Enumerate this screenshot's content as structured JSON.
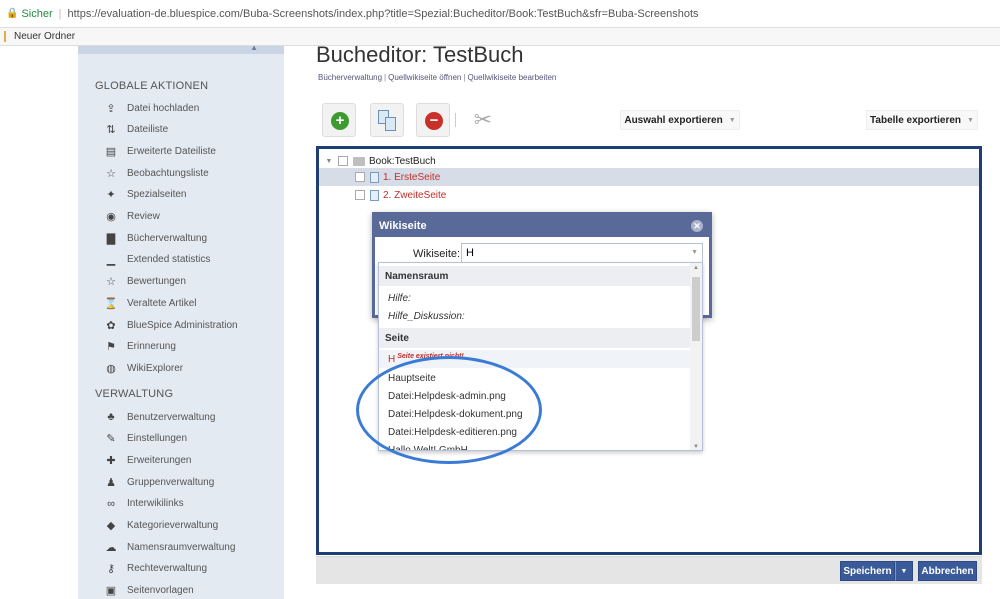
{
  "browser": {
    "secure_label": "Sicher",
    "url": "https://evaluation-de.bluespice.com/Buba-Screenshots/index.php?title=Spezial:Bucheditor/Book:TestBuch&sfr=Buba-Screenshots",
    "bookmark_folder": "Neuer Ordner"
  },
  "sidebar": {
    "global_title": "GLOBALE AKTIONEN",
    "global_items": [
      {
        "label": "Datei hochladen",
        "icon": "upload-icon"
      },
      {
        "label": "Dateiliste",
        "icon": "sort-icon"
      },
      {
        "label": "Erweiterte Dateiliste",
        "icon": "list-icon"
      },
      {
        "label": "Beobachtungsliste",
        "icon": "star-icon"
      },
      {
        "label": "Spezialseiten",
        "icon": "special-icon"
      },
      {
        "label": "Review",
        "icon": "eye-icon"
      },
      {
        "label": "Bücherverwaltung",
        "icon": "book-icon"
      },
      {
        "label": "Extended statistics",
        "icon": "chart-icon"
      },
      {
        "label": "Bewertungen",
        "icon": "star-icon"
      },
      {
        "label": "Veraltete Artikel",
        "icon": "hourglass-icon"
      },
      {
        "label": "BlueSpice Administration",
        "icon": "gear-icon"
      },
      {
        "label": "Erinnerung",
        "icon": "flag-icon"
      },
      {
        "label": "WikiExplorer",
        "icon": "globe-icon"
      }
    ],
    "admin_title": "VERWALTUNG",
    "admin_items": [
      {
        "label": "Benutzerverwaltung",
        "icon": "users-icon"
      },
      {
        "label": "Einstellungen",
        "icon": "wrench-icon"
      },
      {
        "label": "Erweiterungen",
        "icon": "puzzle-icon"
      },
      {
        "label": "Gruppenverwaltung",
        "icon": "group-icon"
      },
      {
        "label": "Interwikilinks",
        "icon": "link-icon"
      },
      {
        "label": "Kategorieverwaltung",
        "icon": "tag-icon"
      },
      {
        "label": "Namensraumverwaltung",
        "icon": "cloud-icon"
      },
      {
        "label": "Rechteverwaltung",
        "icon": "key-icon"
      },
      {
        "label": "Seitenvorlagen",
        "icon": "template-icon"
      }
    ]
  },
  "main": {
    "title": "Bucheditor: TestBuch",
    "subnav": [
      "Bücherverwaltung",
      "Quellwikiseite öffnen",
      "Quellwikiseite bearbeiten"
    ],
    "toolbar": {
      "add_symbol": "+",
      "remove_symbol": "−",
      "tools_symbol": "✂",
      "export_selection": "Auswahl exportieren",
      "export_table": "Tabelle exportieren"
    },
    "tree": {
      "book": "Book:TestBuch",
      "chapters": [
        "1. ErsteSeite",
        "2. ZweiteSeite"
      ]
    },
    "dialog": {
      "title": "Wikiseite",
      "field_label": "Wikiseite:",
      "field_value": "H"
    },
    "dropdown": {
      "namespace_header": "Namensraum",
      "namespaces": [
        "Hilfe:",
        "Hilfe_Diskussion:"
      ],
      "page_header": "Seite",
      "missing_prefix": "H",
      "missing_note": "Seite existiert nicht!",
      "pages": [
        "Hauptseite",
        "Datei:Helpdesk-admin.png",
        "Datei:Helpdesk-dokument.png",
        "Datei:Helpdesk-editieren.png",
        "Hallo Welt! GmbH"
      ]
    },
    "buttons": {
      "save": "Speichern",
      "cancel": "Abbrechen"
    }
  },
  "colors": {
    "primary": "#3a5a9a",
    "panel_border": "#1f3f74",
    "highlight_circle": "#3a7bd5",
    "missing_red": "#c0302a"
  }
}
